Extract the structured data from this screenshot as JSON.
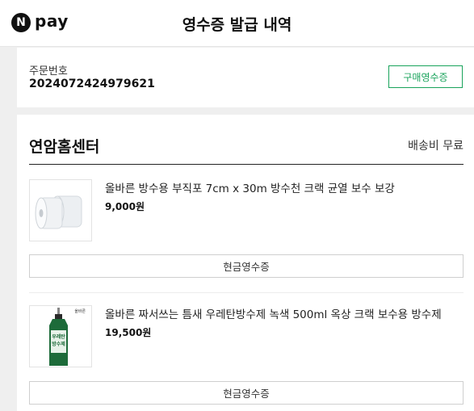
{
  "header": {
    "logo_letter": "N",
    "logo_text": "pay",
    "title": "영수증 발급 내역"
  },
  "order": {
    "label": "주문번호",
    "number": "2024072424979621",
    "purchase_receipt_button": "구매영수증"
  },
  "store": {
    "name": "연암홈센터",
    "shipping": "배송비 무료"
  },
  "items": [
    {
      "name": "올바른 방수용 부직포 7cm x 30m 방수천 크랙 균열 보수 보강",
      "price": "9,000원",
      "cash_receipt_button": "현금영수증",
      "thumb_icon": "fabric-roll-icon"
    },
    {
      "name": "올바른 짜서쓰는 틈새 우레탄방수제 녹색 500ml 옥상 크랙 보수용 방수제",
      "price": "19,500원",
      "cash_receipt_button": "현금영수증",
      "thumb_icon": "green-bottle-icon",
      "thumb_brand": "올바른",
      "thumb_label_line1": "우레탄",
      "thumb_label_line2": "방수제"
    }
  ],
  "colors": {
    "accent_green": "#19a35b",
    "background_gray": "#efefef",
    "bottle_green": "#1d6b3a"
  }
}
